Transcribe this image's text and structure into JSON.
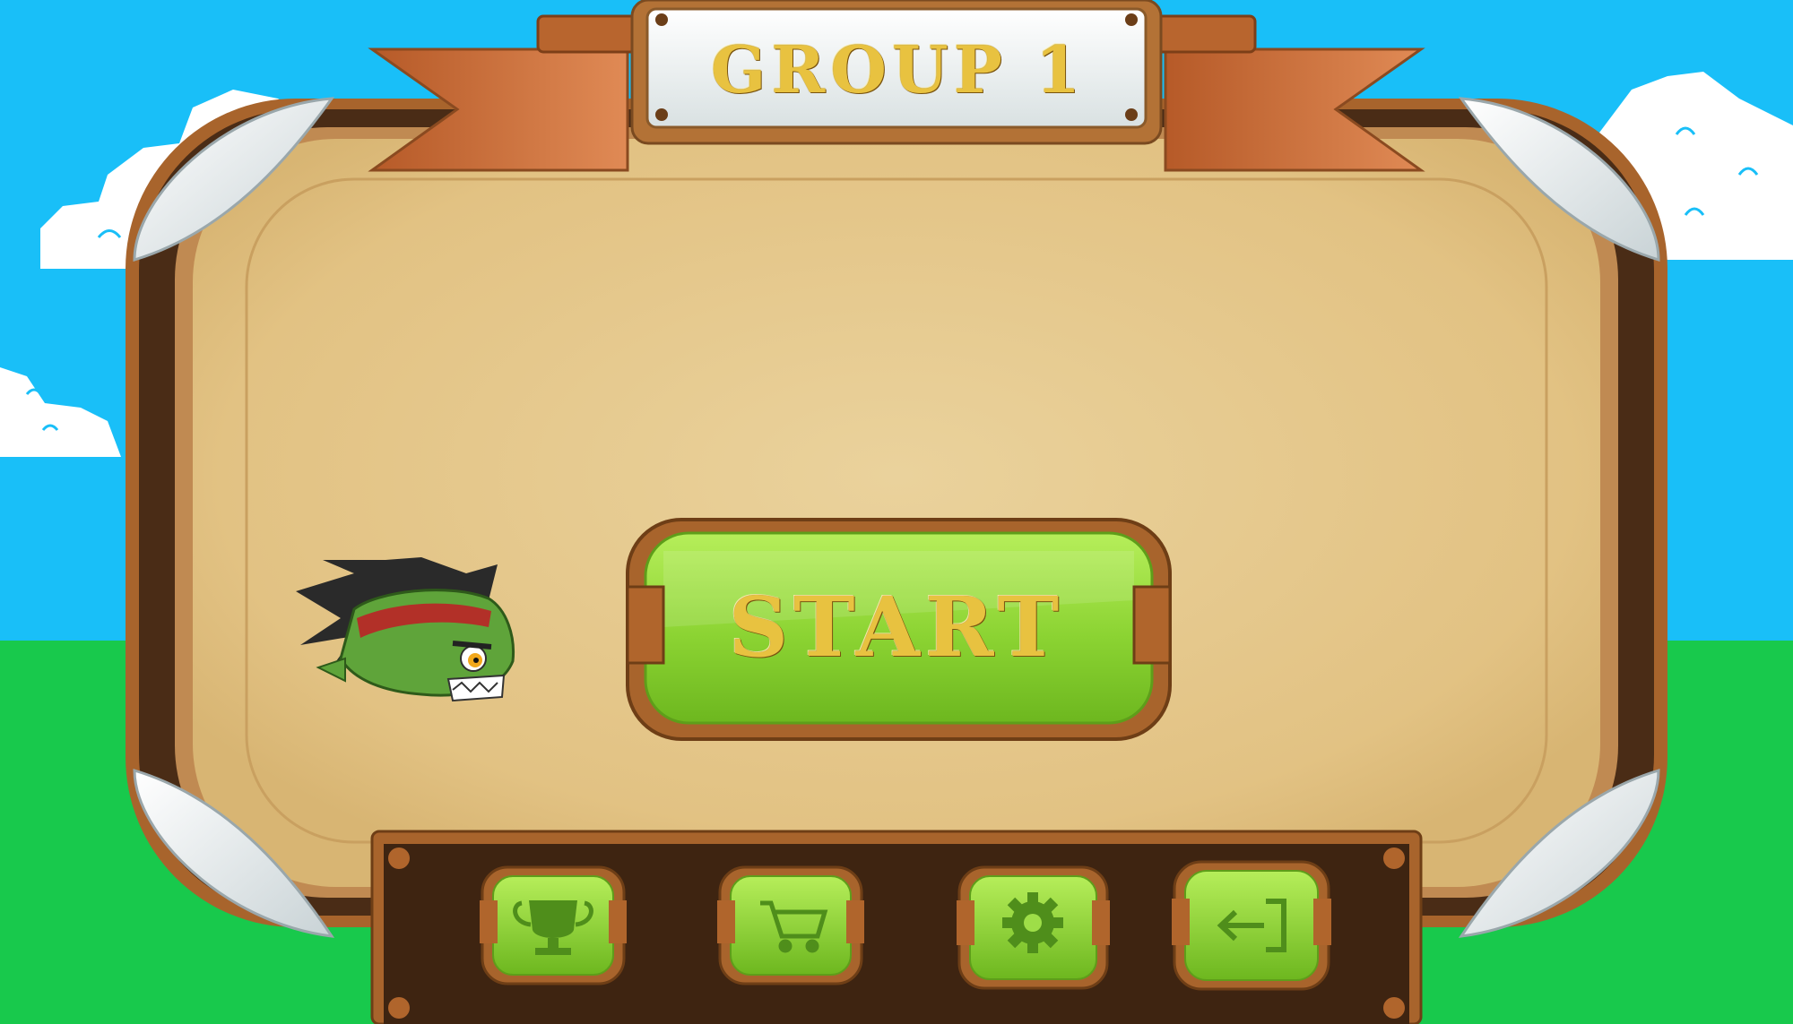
{
  "header": {
    "title": "GROUP 1"
  },
  "main": {
    "start_label": "START"
  },
  "toolbar": {
    "items": [
      {
        "name": "trophy-button",
        "icon": "trophy-icon"
      },
      {
        "name": "shop-button",
        "icon": "shopping-cart-icon"
      },
      {
        "name": "settings-button",
        "icon": "gear-icon"
      },
      {
        "name": "exit-button",
        "icon": "exit-door-icon"
      }
    ]
  },
  "character": {
    "icon": "green-goblin-character"
  },
  "colors": {
    "sky": "#19bff8",
    "grass": "#18c94c",
    "parchment": "#e6c98c",
    "wood_dark": "#4a2c16",
    "wood_light": "#b06b2e",
    "button_green": "#8fd93a",
    "ribbon": "#c8703c",
    "title_gold": "#e8c240"
  }
}
